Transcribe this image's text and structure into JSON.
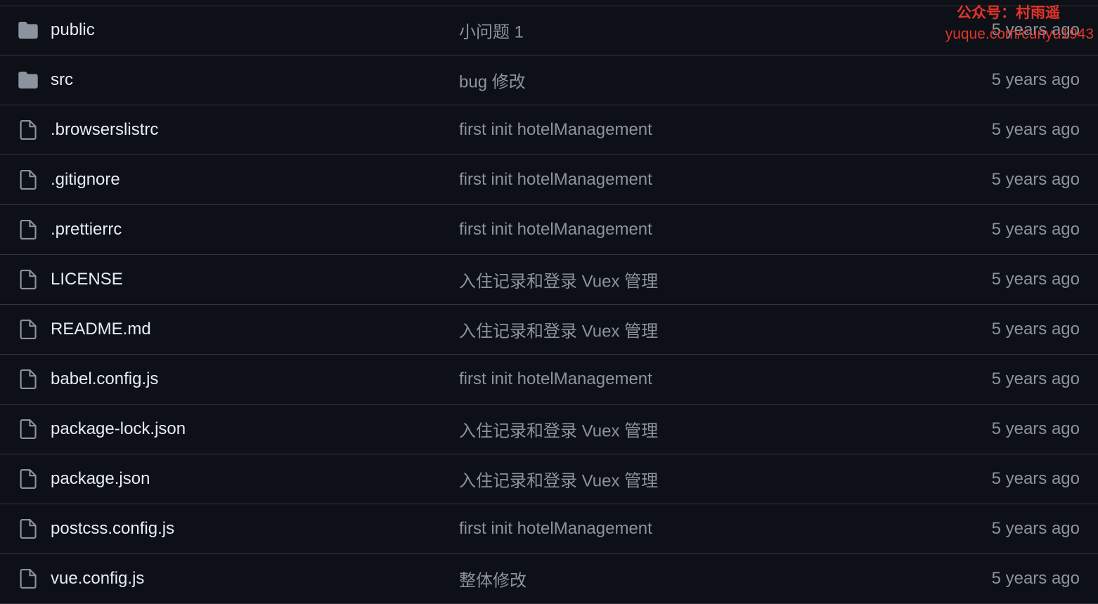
{
  "files": [
    {
      "type": "folder",
      "icon": "folder-icon",
      "name": "public",
      "commit": "小问题 1",
      "age": "5 years ago"
    },
    {
      "type": "folder",
      "icon": "folder-icon",
      "name": "src",
      "commit": "bug 修改",
      "age": "5 years ago"
    },
    {
      "type": "file",
      "icon": "file-icon",
      "name": ".browserslistrc",
      "commit": "first init hotelManagement",
      "age": "5 years ago"
    },
    {
      "type": "file",
      "icon": "file-icon",
      "name": ".gitignore",
      "commit": "first init hotelManagement",
      "age": "5 years ago"
    },
    {
      "type": "file",
      "icon": "file-icon",
      "name": ".prettierrc",
      "commit": "first init hotelManagement",
      "age": "5 years ago"
    },
    {
      "type": "file",
      "icon": "file-icon",
      "name": "LICENSE",
      "commit": "入住记录和登录 Vuex 管理",
      "age": "5 years ago"
    },
    {
      "type": "file",
      "icon": "file-icon",
      "name": "README.md",
      "commit": "入住记录和登录 Vuex 管理",
      "age": "5 years ago"
    },
    {
      "type": "file",
      "icon": "file-icon",
      "name": "babel.config.js",
      "commit": "first init hotelManagement",
      "age": "5 years ago"
    },
    {
      "type": "file",
      "icon": "file-icon",
      "name": "package-lock.json",
      "commit": "入住记录和登录 Vuex 管理",
      "age": "5 years ago"
    },
    {
      "type": "file",
      "icon": "file-icon",
      "name": "package.json",
      "commit": "入住记录和登录 Vuex 管理",
      "age": "5 years ago"
    },
    {
      "type": "file",
      "icon": "file-icon",
      "name": "postcss.config.js",
      "commit": "first init hotelManagement",
      "age": "5 years ago"
    },
    {
      "type": "file",
      "icon": "file-icon",
      "name": "vue.config.js",
      "commit": "整体修改",
      "age": "5 years ago"
    }
  ],
  "watermark": {
    "line1": "公众号：村雨遥",
    "line2": "yuque.com/cunyu1943"
  },
  "colors": {
    "background": "#0d1117",
    "border": "#30363d",
    "filename": "#e6edf3",
    "muted": "#8b949e",
    "icon": "#8b949e",
    "watermark": "#e5332a"
  }
}
